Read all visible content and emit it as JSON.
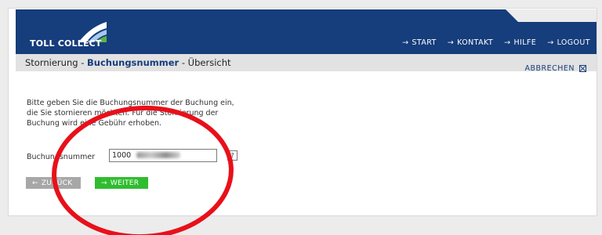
{
  "brand": {
    "name": "TOLL COLLECT"
  },
  "nav": {
    "items": [
      {
        "arrow": "→",
        "label": "START"
      },
      {
        "arrow": "→",
        "label": "KONTAKT"
      },
      {
        "arrow": "→",
        "label": "HILFE"
      },
      {
        "arrow": "→",
        "label": "LOGOUT"
      }
    ]
  },
  "breadcrumb": {
    "part1": "Stornierung - ",
    "part2": "Buchungsnummer",
    "part3": " - Übersicht"
  },
  "cancel": {
    "label": "ABBRECHEN"
  },
  "instructions": {
    "lines": [
      "Bitte geben Sie die Buchungsnummer der Buchung ein,",
      "die Sie stornieren möchten. Für die Stornierung der",
      "Buchung wird eine Gebühr erhoben."
    ]
  },
  "form": {
    "label": "Buchungsnummer",
    "value": "1000",
    "help": "?"
  },
  "buttons": {
    "back_arrow": "←",
    "back": "ZURÜCK",
    "next_arrow": "→",
    "next": "WEITER"
  },
  "colors": {
    "brand_blue": "#163d7c",
    "go_green": "#2fbd2f",
    "annotation_red": "#e8101a"
  }
}
